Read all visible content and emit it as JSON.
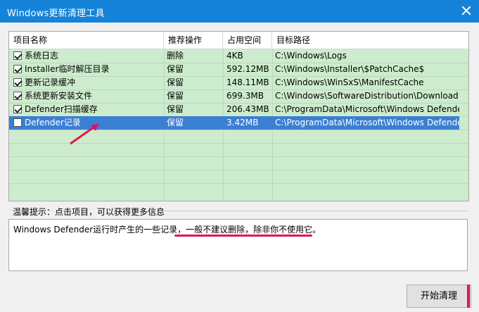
{
  "window": {
    "title": "Windows更新清理工具"
  },
  "table": {
    "headers": [
      "项目名称",
      "推荐操作",
      "占用空间",
      "目标路径"
    ],
    "rows": [
      {
        "name": "系统日志",
        "action": "删除",
        "size": "4KB",
        "path": "C:\\Windows\\Logs",
        "checked": true,
        "selected": false
      },
      {
        "name": "Installer临时解压目录",
        "action": "保留",
        "size": "592.12MB",
        "path": "C:\\Windows\\Installer\\$PatchCache$",
        "checked": true,
        "selected": false
      },
      {
        "name": "更新记录缓冲",
        "action": "保留",
        "size": "148.11MB",
        "path": "C:\\Windows\\WinSxS\\ManifestCache",
        "checked": true,
        "selected": false
      },
      {
        "name": "系统更新安装文件",
        "action": "保留",
        "size": "699.3MB",
        "path": "C:\\Windows\\SoftwareDistribution\\Download",
        "checked": true,
        "selected": false
      },
      {
        "name": "Defender扫描缓存",
        "action": "保留",
        "size": "206.43MB",
        "path": "C:\\ProgramData\\Microsoft\\Windows Defender...",
        "checked": true,
        "selected": false
      },
      {
        "name": "Defender记录",
        "action": "保留",
        "size": "3.42MB",
        "path": "C:\\ProgramData\\Microsoft\\Windows Defender...",
        "checked": false,
        "selected": true
      }
    ]
  },
  "tip": {
    "label": "温馨提示：点击项目，可以获得更多信息"
  },
  "description": {
    "text": "Windows Defender运行时产生的一些记录，一般不建议删除，除非你不使用它。"
  },
  "buttons": {
    "start_cleanup": "开始清理"
  },
  "colors": {
    "titlebar": "#1583d8",
    "list_bg": "#cdeccd",
    "selected": "#3b7fd3",
    "annotation": "#e0145c"
  }
}
